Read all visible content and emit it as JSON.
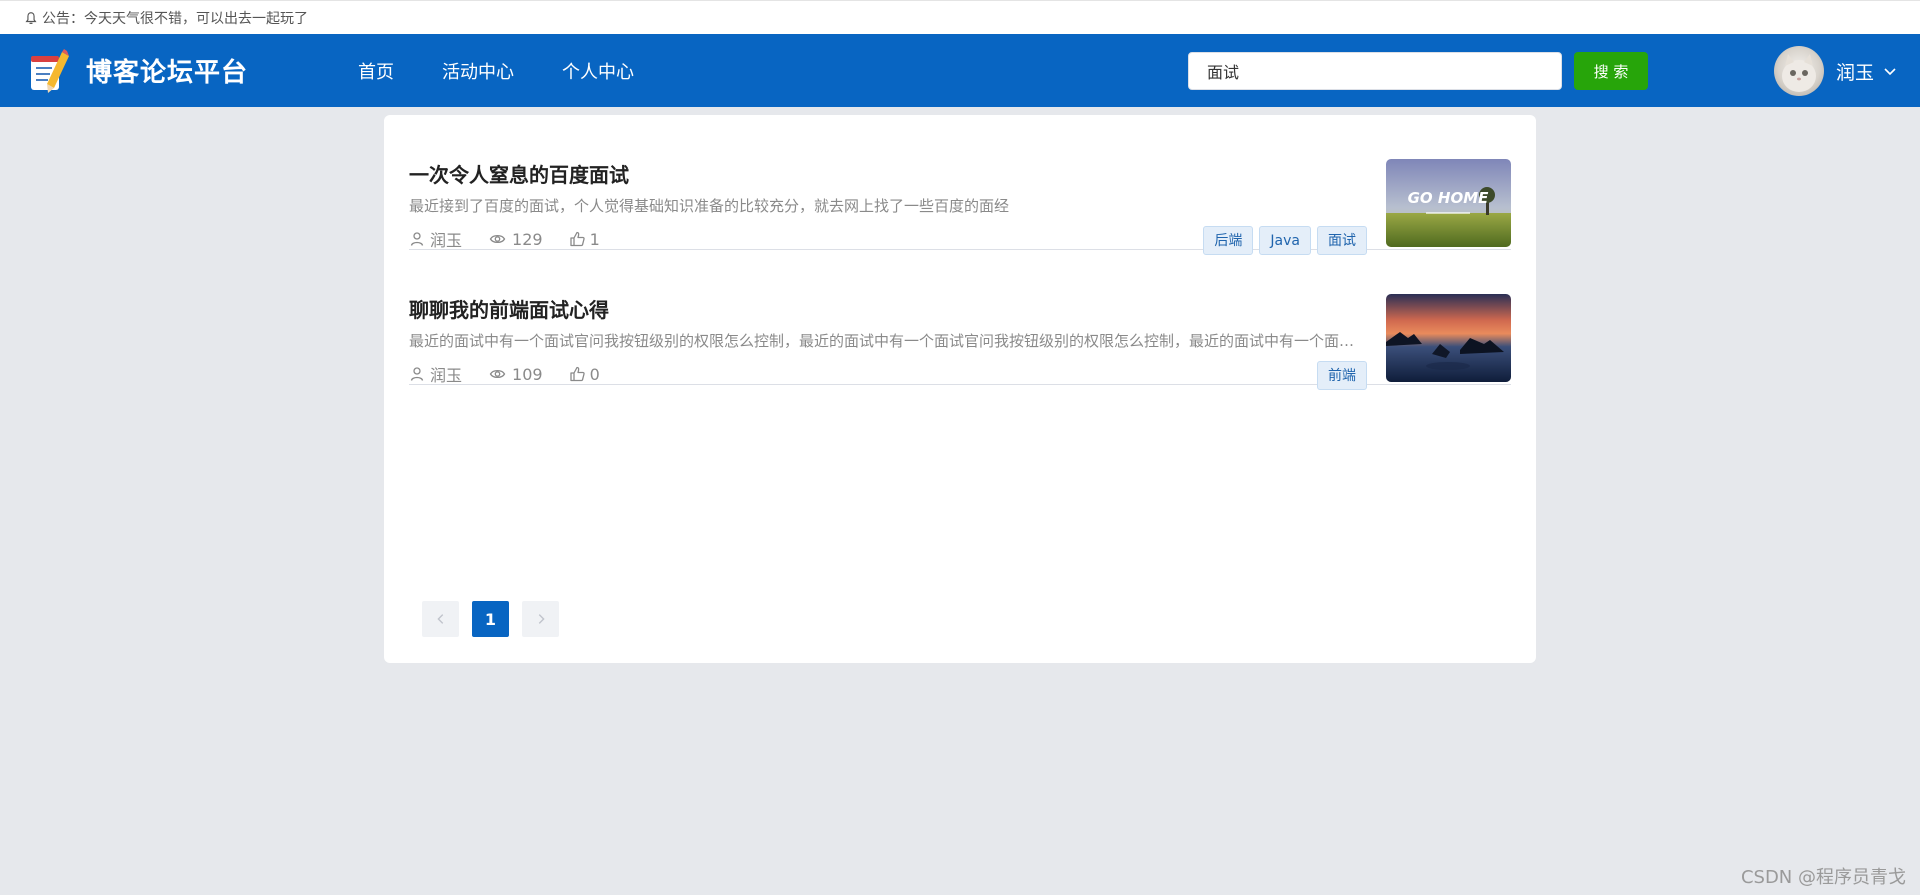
{
  "notice": {
    "text": "公告：今天天气很不错，可以出去一起玩了"
  },
  "header": {
    "title": "博客论坛平台",
    "nav": [
      {
        "label": "首页"
      },
      {
        "label": "活动中心"
      },
      {
        "label": "个人中心"
      }
    ],
    "search": {
      "value": "面试",
      "button_label": "搜 索"
    },
    "user": {
      "name": "润玉"
    },
    "colors": {
      "navbar": "#0865c2",
      "search_button": "#27a50a"
    }
  },
  "posts": [
    {
      "title": "一次令人窒息的百度面试",
      "desc": "最近接到了百度的面试，个人觉得基础知识准备的比较充分，就去网上找了一些百度的面经",
      "author": "润玉",
      "views": "129",
      "likes": "1",
      "tags": [
        "后端",
        "Java",
        "面试"
      ],
      "thumb_text": "GO HOME"
    },
    {
      "title": "聊聊我的前端面试心得",
      "desc": "最近的面试中有一个面试官问我按钮级别的权限怎么控制，最近的面试中有一个面试官问我按钮级别的权限怎么控制，最近的面试中有一个面试官问我按钮级别的权限怎么控制",
      "author": "润玉",
      "views": "109",
      "likes": "0",
      "tags": [
        "前端"
      ]
    }
  ],
  "pagination": {
    "current": "1",
    "prev_icon": "chevron-left-icon",
    "next_icon": "chevron-right-icon"
  },
  "watermark": "CSDN @程序员青戈"
}
